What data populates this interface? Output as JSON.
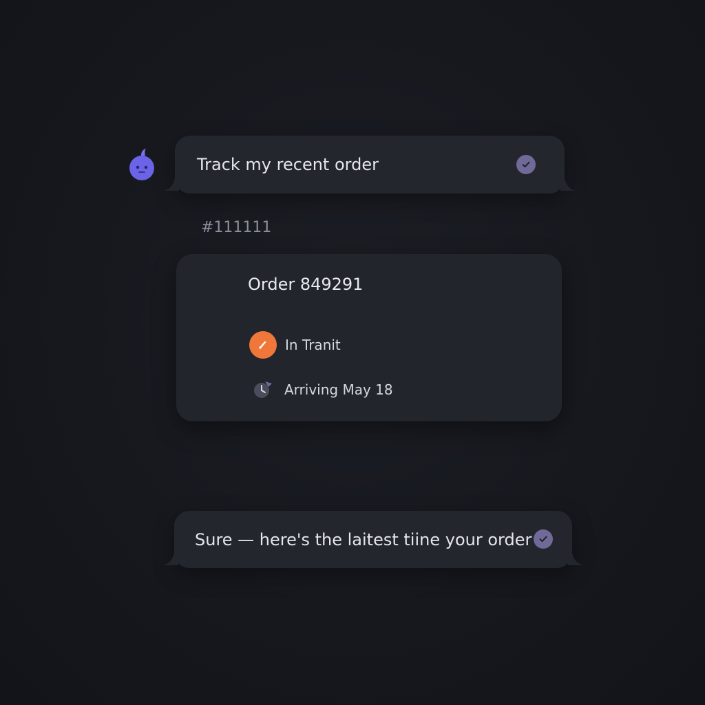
{
  "conversation": {
    "user_message": {
      "text": "Track my recent order",
      "status_icon": "check-circle-icon"
    },
    "reference_id": "#111111",
    "order_card": {
      "title": "Order 849291",
      "status": {
        "label": "In Tranit",
        "icon": "truck-icon",
        "color": "#f0773a"
      },
      "arrival": {
        "label": "Arriving May 18",
        "icon": "clock-icon"
      }
    },
    "assistant_reply": {
      "text": "Sure — here's the laitest tiine your order",
      "status_icon": "check-circle-icon"
    }
  },
  "avatar": {
    "icon": "bot-avatar-icon",
    "color": "#6b63e8"
  },
  "theme": {
    "background": "#16181e",
    "bubble": "#24262e",
    "check": "#6f6a97"
  }
}
